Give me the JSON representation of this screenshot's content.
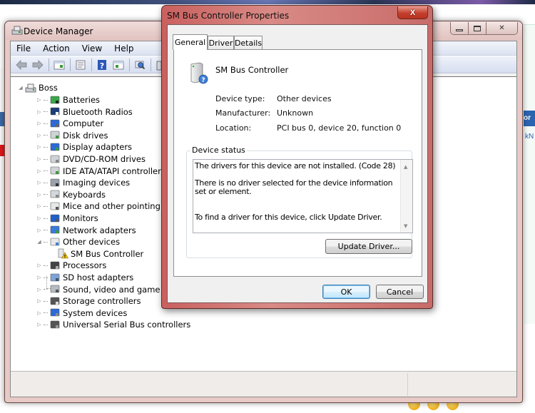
{
  "device_manager": {
    "title": "Device Manager",
    "menu": [
      "File",
      "Action",
      "View",
      "Help"
    ],
    "toolbar_icons": [
      "back-icon",
      "forward-icon",
      "show-hide-console-tree-icon",
      "properties-icon",
      "help-icon",
      "action-pane-icon",
      "scan-hardware-icon",
      "update-driver-icon"
    ],
    "tree": {
      "root": "Boss",
      "categories": [
        {
          "label": "Batteries",
          "icon": "battery-icon",
          "expanded": false
        },
        {
          "label": "Bluetooth Radios",
          "icon": "bluetooth-icon",
          "expanded": false
        },
        {
          "label": "Computer",
          "icon": "computer-icon",
          "expanded": false
        },
        {
          "label": "Disk drives",
          "icon": "disk-drive-icon",
          "expanded": false
        },
        {
          "label": "Display adapters",
          "icon": "display-adapter-icon",
          "expanded": false
        },
        {
          "label": "DVD/CD-ROM drives",
          "icon": "dvd-drive-icon",
          "expanded": false
        },
        {
          "label": "IDE ATA/ATAPI controllers",
          "icon": "ide-controller-icon",
          "expanded": false
        },
        {
          "label": "Imaging devices",
          "icon": "imaging-device-icon",
          "expanded": false
        },
        {
          "label": "Keyboards",
          "icon": "keyboard-icon",
          "expanded": false
        },
        {
          "label": "Mice and other pointing devices",
          "icon": "mouse-icon",
          "expanded": false
        },
        {
          "label": "Monitors",
          "icon": "monitor-icon",
          "expanded": false
        },
        {
          "label": "Network adapters",
          "icon": "network-adapter-icon",
          "expanded": false
        },
        {
          "label": "Other devices",
          "icon": "unknown-device-icon",
          "expanded": true
        },
        {
          "label": "Processors",
          "icon": "processor-icon",
          "expanded": false
        },
        {
          "label": "SD host adapters",
          "icon": "sd-host-icon",
          "expanded": false
        },
        {
          "label": "Sound, video and game controllers",
          "icon": "sound-icon",
          "expanded": false
        },
        {
          "label": "Storage controllers",
          "icon": "storage-controller-icon",
          "expanded": false
        },
        {
          "label": "System devices",
          "icon": "system-device-icon",
          "expanded": false
        },
        {
          "label": "Universal Serial Bus controllers",
          "icon": "usb-icon",
          "expanded": false
        }
      ],
      "other_devices_children": [
        {
          "label": "SM Bus Controller",
          "icon": "warning-device-icon"
        }
      ]
    }
  },
  "properties_dialog": {
    "title": "SM Bus Controller Properties",
    "close_label": "X",
    "tabs": [
      {
        "label": "General",
        "active": true
      },
      {
        "label": "Driver",
        "active": false
      },
      {
        "label": "Details",
        "active": false
      }
    ],
    "device_name": "SM Bus Controller",
    "properties": [
      {
        "label": "Device type:",
        "value": "Other devices"
      },
      {
        "label": "Manufacturer:",
        "value": "Unknown"
      },
      {
        "label": "Location:",
        "value": "PCI bus 0, device 20, function 0"
      }
    ],
    "status_group_label": "Device status",
    "status_lines": [
      "The drivers for this device are not installed. (Code 28)",
      "There is no driver selected for the device information set or element.",
      "To find a driver for this device, click Update Driver."
    ],
    "update_driver_label": "Update Driver...",
    "ok_label": "OK",
    "cancel_label": "Cancel"
  },
  "background": {
    "right_panel_text": "or",
    "right_link_text": "kN"
  }
}
